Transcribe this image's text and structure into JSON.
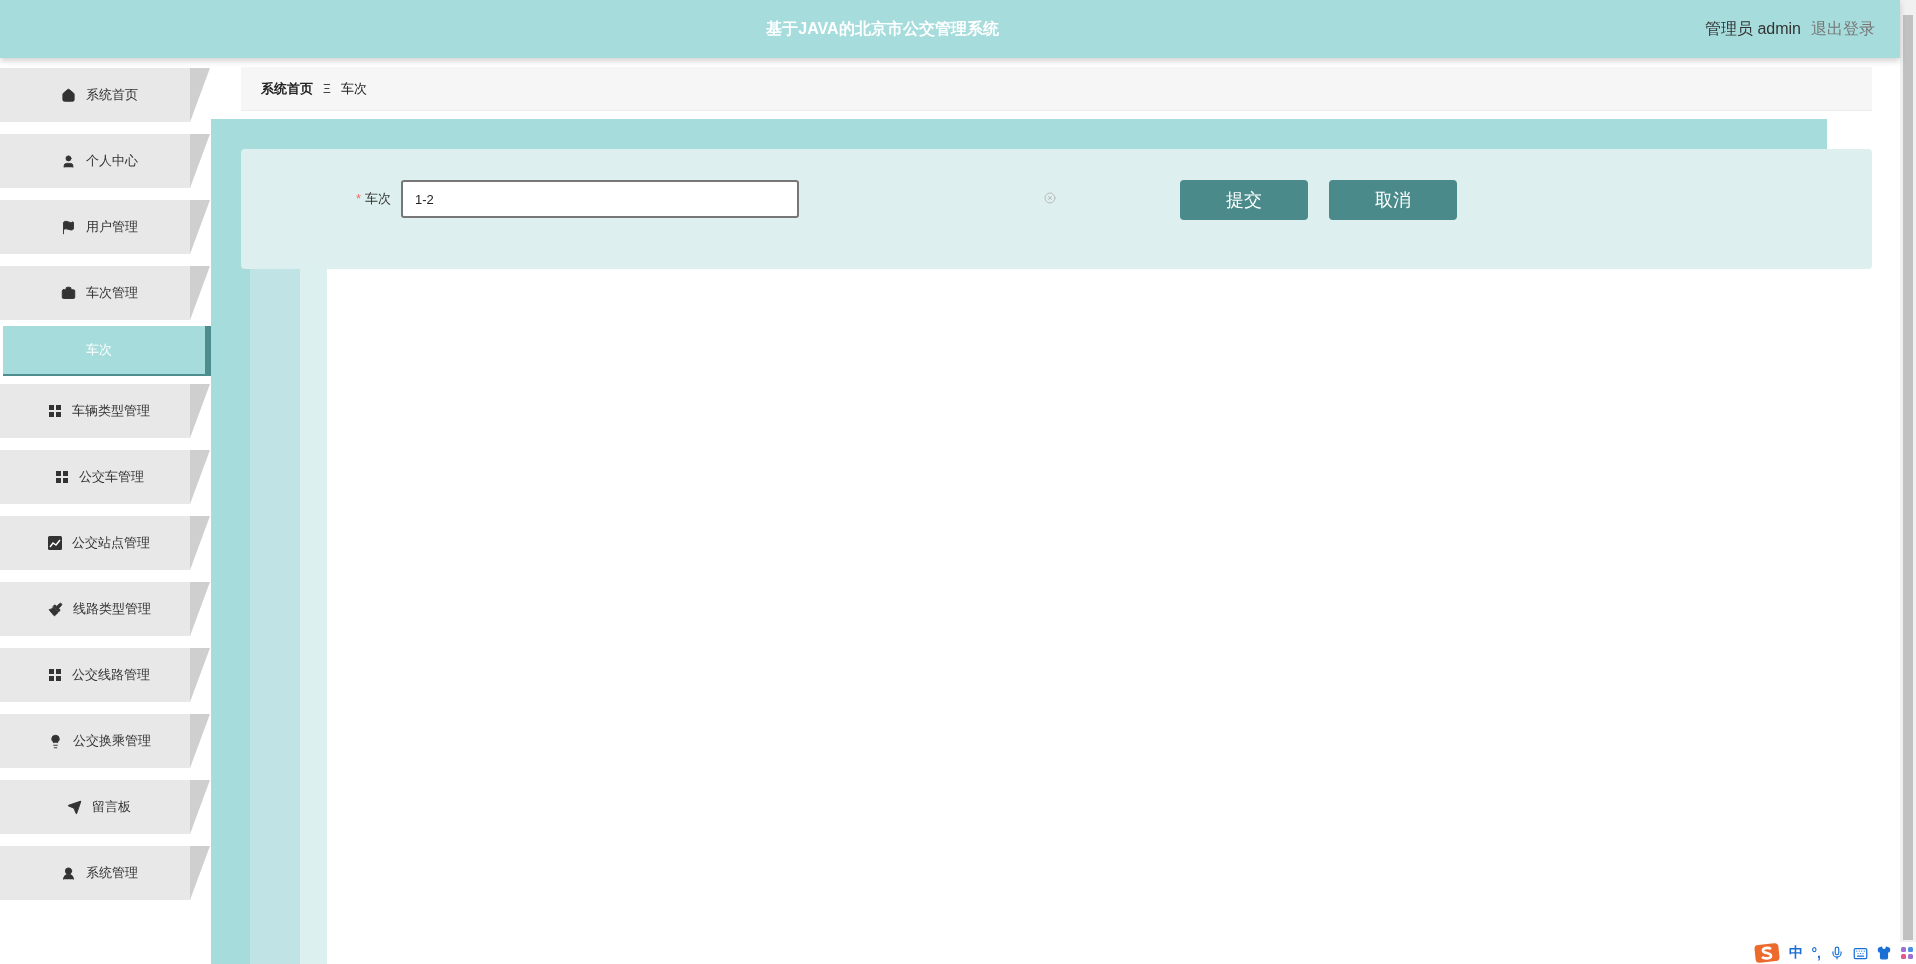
{
  "header": {
    "title": "基于JAVA的北京市公交管理系统",
    "user_label": "管理员 admin",
    "logout": "退出登录"
  },
  "sidebar": {
    "items": [
      {
        "label": "系统首页",
        "selected": false
      },
      {
        "label": "个人中心",
        "selected": false
      },
      {
        "label": "用户管理",
        "selected": false
      },
      {
        "label": "车次管理",
        "selected": false,
        "expanded": true,
        "children": [
          {
            "label": "车次",
            "selected": true
          }
        ]
      },
      {
        "label": "车辆类型管理",
        "selected": false
      },
      {
        "label": "公交车管理",
        "selected": false
      },
      {
        "label": "公交站点管理",
        "selected": false
      },
      {
        "label": "线路类型管理",
        "selected": false
      },
      {
        "label": "公交线路管理",
        "selected": false
      },
      {
        "label": "公交换乘管理",
        "selected": false
      },
      {
        "label": "留言板",
        "selected": false
      },
      {
        "label": "系统管理",
        "selected": false
      }
    ]
  },
  "breadcrumb": {
    "items": [
      "系统首页",
      "车次"
    ],
    "separator": "Ξ"
  },
  "form": {
    "fields": [
      {
        "label": "车次",
        "required": true,
        "required_mark": "*",
        "value": "1-2"
      }
    ],
    "buttons": [
      "提交",
      "取消"
    ]
  },
  "ime_toolbar": {
    "mode": "中",
    "punctuation": "°,"
  }
}
